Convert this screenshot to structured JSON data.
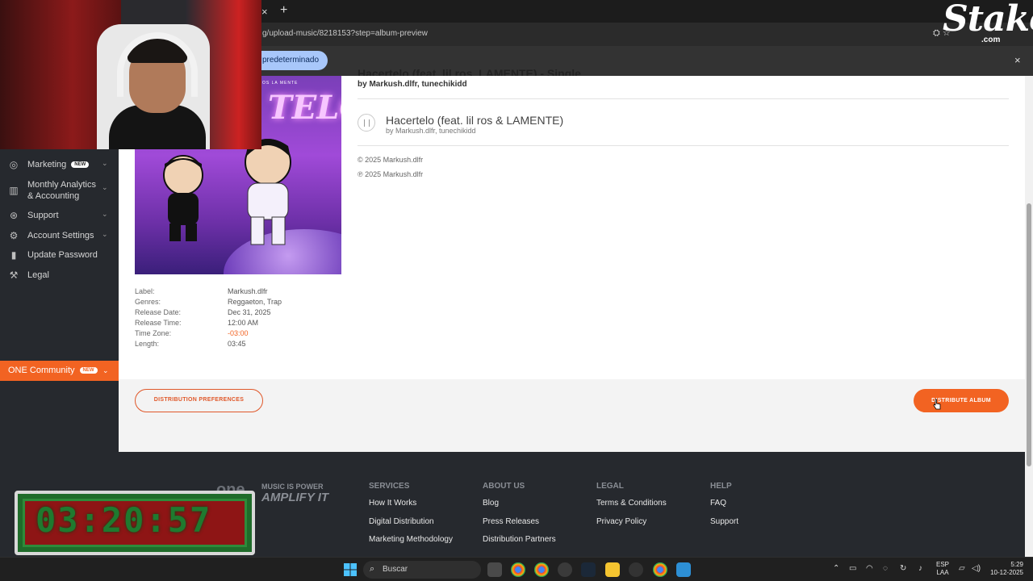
{
  "browser": {
    "url": "g/upload-music/8218153?step=album-preview",
    "tab_close": "×",
    "tab_new": "+",
    "infobar_pill": "predeterminado",
    "infobar_close": "×"
  },
  "stake_logo": {
    "word": "Stake",
    "com": ".com"
  },
  "sidebar": {
    "items": [
      {
        "label": "Marketing",
        "badge": "NEW",
        "icon": "target-icon"
      },
      {
        "label": "Monthly Analytics & Accounting",
        "icon": "bar-chart-icon"
      },
      {
        "label": "Support",
        "icon": "lifebuoy-icon"
      },
      {
        "label": "Account Settings",
        "icon": "gear-icon"
      },
      {
        "label": "Update Password",
        "icon": "lock-icon"
      },
      {
        "label": "Legal",
        "icon": "gavel-icon"
      }
    ],
    "community": {
      "label": "ONE Community",
      "badge": "NEW"
    },
    "marketing_label": "Marketing",
    "analytics_line1": "Monthly Analytics",
    "analytics_line2": "& Accounting",
    "support_label": "Support",
    "account_label": "Account Settings",
    "password_label": "Update Password",
    "legal_label": "Legal",
    "new_badge": "NEW"
  },
  "cover": {
    "art_title": "TELO",
    "art_artists": "OS   LA MENTE"
  },
  "album": {
    "title": "Hacertelo (feat. lil ros, LAMENTE) - Single",
    "by": "by Markush.dlfr, tunechikidd",
    "track_title": "Hacertelo (feat. lil ros & LAMENTE)",
    "track_by": "by Markush.dlfr, tunechikidd",
    "copyright": "© 2025 Markush.dlfr",
    "phonogram": "℗ 2025 Markush.dlfr"
  },
  "meta": {
    "label_k": "Label:",
    "label_v": "Markush.dlfr",
    "genres_k": "Genres:",
    "genres_v": "Reggaeton, Trap",
    "date_k": "Release Date:",
    "date_v": "Dec 31, 2025",
    "time_k": "Release Time:",
    "time_v": "12:00 AM",
    "tz_k": "Time Zone:",
    "tz_v": "-03:00",
    "length_k": "Length:",
    "length_v": "03:45"
  },
  "actions": {
    "preferences": "DISTRIBUTION PREFERENCES",
    "distribute": "DISTRIBUTE ALBUM"
  },
  "footer": {
    "brand_one": "one",
    "brand_power": "MUSIC IS POWER",
    "brand_amplify": "AMPLIFY IT",
    "services": {
      "heading": "SERVICES",
      "links": [
        "How It Works",
        "Digital Distribution",
        "Marketing Methodology"
      ]
    },
    "about": {
      "heading": "ABOUT US",
      "links": [
        "Blog",
        "Press Releases",
        "Distribution Partners"
      ]
    },
    "legal": {
      "heading": "LEGAL",
      "links": [
        "Terms & Conditions",
        "Privacy Policy"
      ]
    },
    "help": {
      "heading": "HELP",
      "links": [
        "FAQ",
        "Support"
      ]
    }
  },
  "timer": {
    "value": "03:20:57"
  },
  "taskbar": {
    "search_placeholder": "Buscar",
    "lang_line1": "ESP",
    "lang_line2": "LAA",
    "time": "5:29",
    "date": "10-12-2025"
  },
  "colors": {
    "accent": "#f26322",
    "sidebar_bg": "#26292e",
    "page_bg": "#ffffff"
  }
}
